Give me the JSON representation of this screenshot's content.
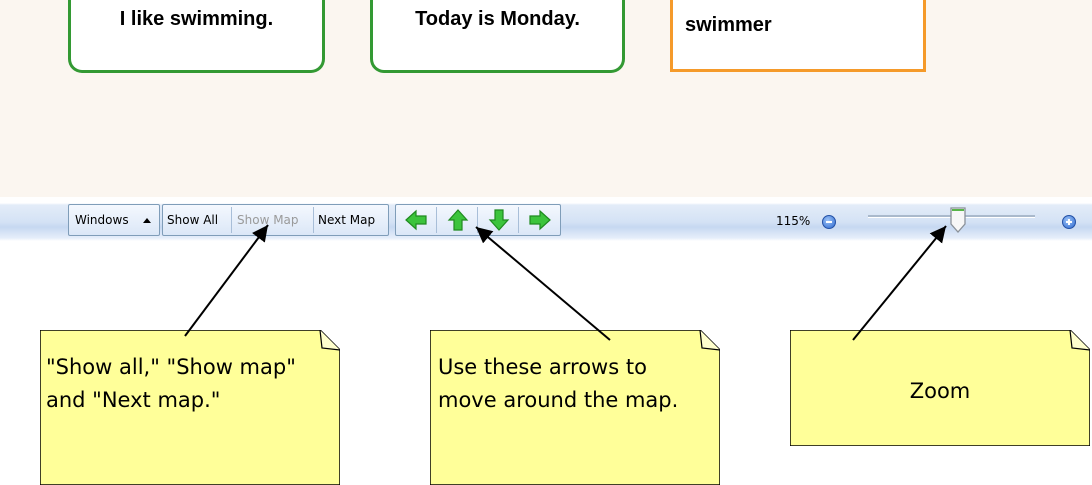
{
  "map": {
    "cards": [
      {
        "text": "I like swimming."
      },
      {
        "text": "Today is Monday."
      },
      {
        "text": "swimmer"
      }
    ]
  },
  "toolbar": {
    "windows_label": "Windows",
    "show_all_label": "Show All",
    "show_map_label": "Show Map",
    "next_map_label": "Next Map",
    "arrows": [
      "arrow-left-icon",
      "arrow-up-icon",
      "arrow-down-icon",
      "arrow-right-icon"
    ],
    "zoom_level_text": "115%",
    "zoom_slider_value_fraction": 0.53
  },
  "callouts": {
    "note_1": "\"Show all,\" \"Show map\" and \"Next map.\"",
    "note_2": "Use these arrows to move around the map.",
    "note_3": "Zoom"
  },
  "colors": {
    "map_background": "#fbf6f0",
    "card_green_border": "#339933",
    "card_orange_border": "#f59a2a",
    "note_yellow": "#ffff99",
    "arrow_green": "#3cc43c",
    "zoom_button_blue": "#2f6ad0"
  }
}
